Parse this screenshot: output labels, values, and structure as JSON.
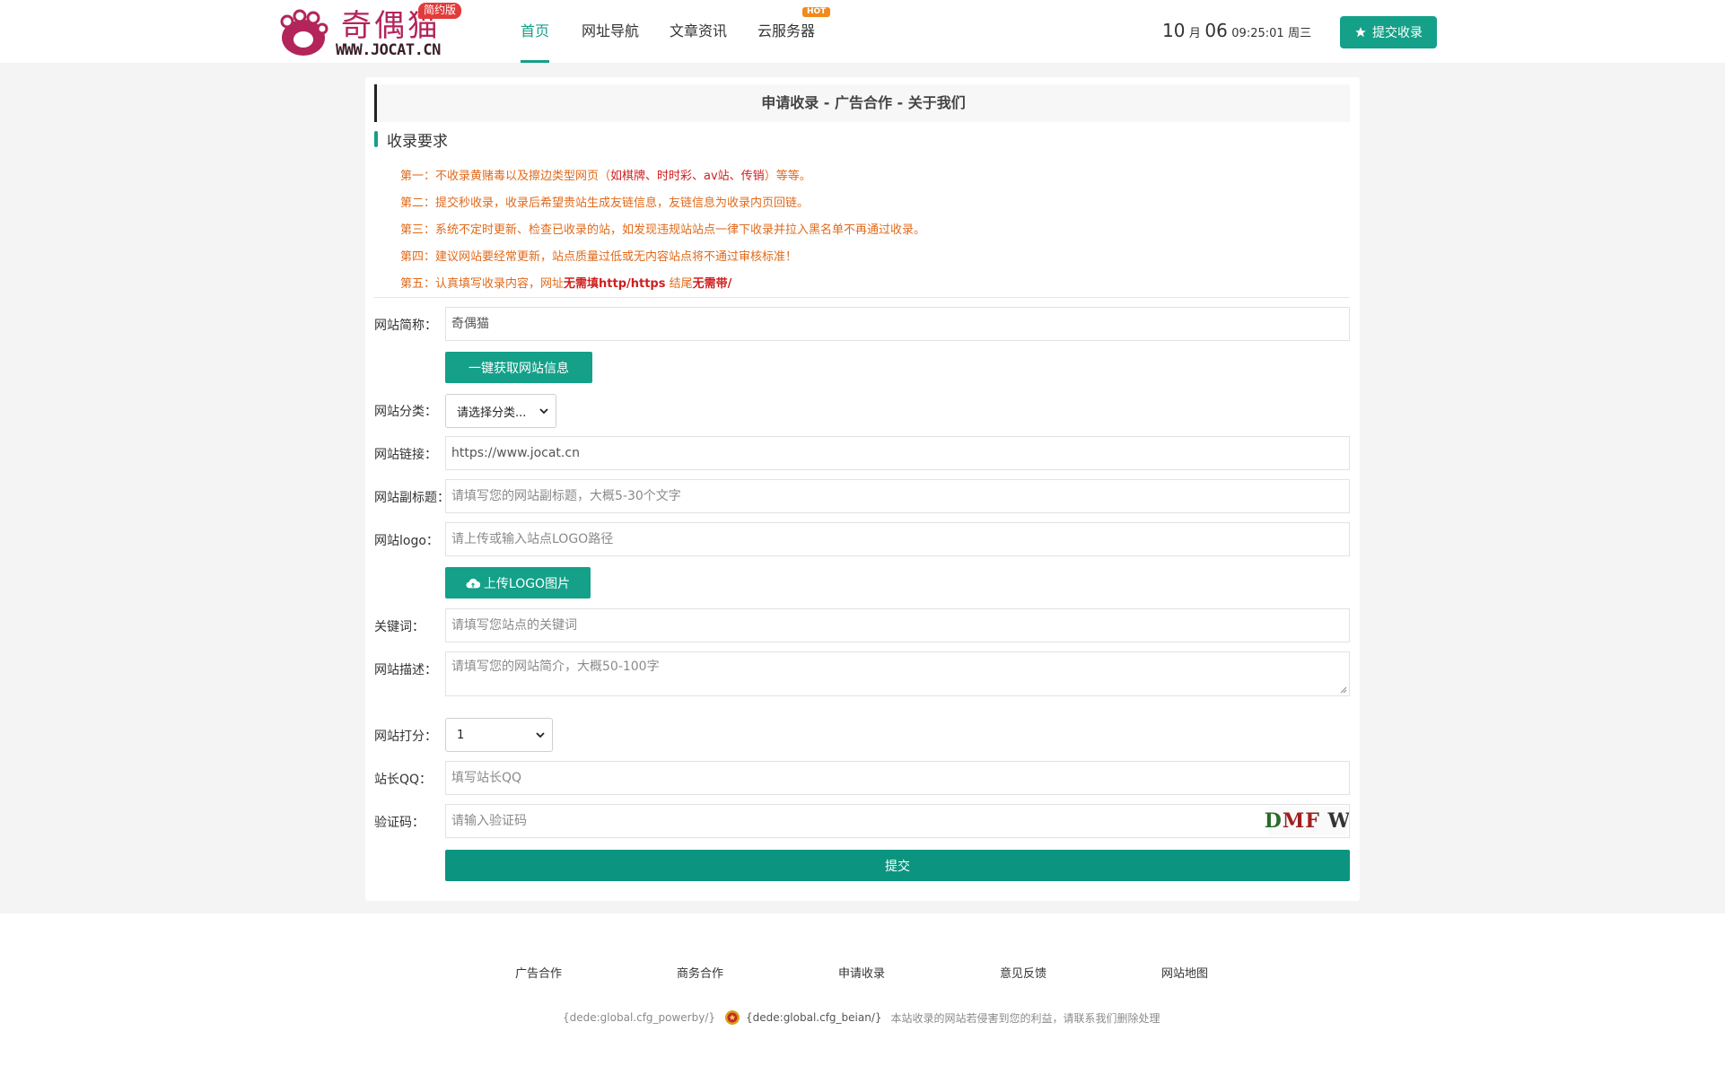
{
  "header": {
    "logo": {
      "cn_text": "奇偶猫",
      "url_text": "WWW.JOCAT.CN",
      "badge": "简约版"
    },
    "nav": [
      {
        "label": "首页",
        "active": true
      },
      {
        "label": "网址导航",
        "active": false
      },
      {
        "label": "文章资讯",
        "active": false
      },
      {
        "label": "云服务器",
        "active": false,
        "badge": "HOT"
      }
    ],
    "date": {
      "month": "10",
      "month_unit": "月",
      "day": "06",
      "time": "09:25:01",
      "weekday": "周三"
    },
    "submit_button": "提交收录"
  },
  "card": {
    "title": "申请收录 - 广告合作 - 关于我们",
    "section_title": "收录要求",
    "rules": {
      "r1": {
        "prefix": "第一：不收录黄赌毒以及擦边类型网页（",
        "red": "如棋牌、时时彩、av站、传销",
        "suffix": "）等等。"
      },
      "r2": "第二：提交秒收录，收录后希望贵站生成友链信息，友链信息为收录内页回链。",
      "r3": "第三：系统不定时更新、检查已收录的站，如发现违规站站点一律下收录并拉入黑名单不再通过收录。",
      "r4": "第四：建议网站要经常更新，站点质量过低或无内容站点将不通过审核标准！",
      "r5": {
        "prefix": "第五：认真填写收录内容，网址",
        "bold1": "无需填http/https",
        "mid": " 结尾",
        "bold2": "无需带/"
      }
    }
  },
  "form": {
    "name": {
      "label": "网站简称：",
      "value": "奇偶猫"
    },
    "fetch_button": "一键获取网站信息",
    "category": {
      "label": "网站分类：",
      "selected": "请选择分类..."
    },
    "url": {
      "label": "网站链接：",
      "value": "https://www.jocat.cn"
    },
    "subtitle": {
      "label": "网站副标题：",
      "placeholder": "请填写您的网站副标题，大概5-30个文字"
    },
    "logo": {
      "label": "网站logo：",
      "placeholder": "请上传或输入站点LOGO路径"
    },
    "upload_button": "上传LOGO图片",
    "keywords": {
      "label": "关键词：",
      "placeholder": "请填写您站点的关键词"
    },
    "description": {
      "label": "网站描述：",
      "placeholder": "请填写您的网站简介，大概50-100字"
    },
    "rating": {
      "label": "网站打分：",
      "selected": "1"
    },
    "qq": {
      "label": "站长QQ：",
      "placeholder": "填写站长QQ"
    },
    "captcha": {
      "label": "验证码：",
      "placeholder": "请输入验证码",
      "code": "DMF W"
    },
    "submit": "提交"
  },
  "footer": {
    "links": [
      "广告合作",
      "商务合作",
      "申请收录",
      "意见反馈",
      "网站地图"
    ],
    "powerby": "{dede:global.cfg_powerby/}",
    "beian": "{dede:global.cfg_beian/}",
    "disclaimer": "本站收录的网站若侵害到您的利益，请联系我们删除处理"
  },
  "colors": {
    "accent": "#14a089",
    "rule_text": "#e06a1b",
    "rule_red": "#d01e1e",
    "logo": "#b3245a"
  }
}
